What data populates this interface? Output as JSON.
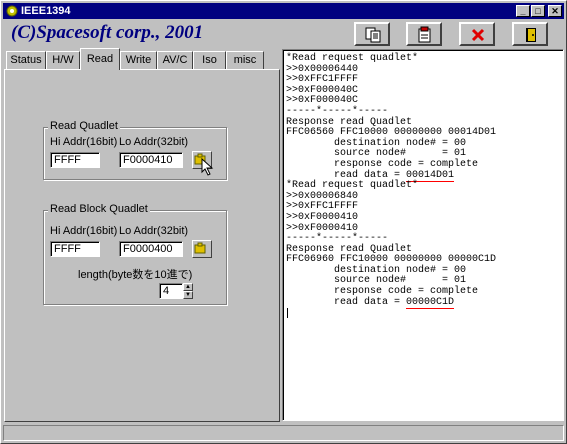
{
  "window": {
    "title": "IEEE1394"
  },
  "header": {
    "brand": "(C)Spacesoft corp., 2001"
  },
  "toolbar": {
    "buttons": [
      {
        "icon": "copy-doc-icon"
      },
      {
        "icon": "paste-doc-icon"
      },
      {
        "icon": "clear-x-icon"
      },
      {
        "icon": "exit-door-icon"
      }
    ]
  },
  "tabs": [
    "Status",
    "H/W",
    "Read",
    "Write",
    "AV/C",
    "Iso",
    "misc"
  ],
  "active_tab": "Read",
  "read_quadlet": {
    "group_label": "Read Quadlet",
    "hi_label": "Hi Addr(16bit)",
    "lo_label": "Lo Addr(32bit)",
    "hi_value": "FFFF",
    "lo_value": "F0000410"
  },
  "read_block": {
    "group_label": "Read Block Quadlet",
    "hi_label": "Hi Addr(16bit)",
    "lo_label": "Lo Addr(32bit)",
    "hi_value": "FFFF",
    "lo_value": "F0000400",
    "length_label": "length(byte数を10進で)",
    "length_value": "4"
  },
  "log": {
    "lines": [
      "*Read request quadlet*",
      ">>0x00006440",
      ">>0xFFC1FFFF",
      ">>0xF000040C",
      ">>0xF000040C",
      "-----*-----*-----",
      "Response read Quadlet",
      "FFC06560 FFC10000 00000000 00014D01",
      "        destination node# = 00",
      "        source node#      = 01",
      "        response code = complete",
      "        read data = |00014D01|",
      "*Read request quadlet*",
      ">>0x00006840",
      ">>0xFFC1FFFF",
      ">>0xF0000410",
      ">>0xF0000410",
      "-----*-----*-----",
      "Response read Quadlet",
      "FFC06960 FFC10000 00000000 00000C1D",
      "        destination node# = 00",
      "        source node#      = 01",
      "        response code = complete",
      "        read data = |00000C1D|"
    ]
  },
  "colors": {
    "title_bar": "#000080",
    "brand_text": "#000080",
    "highlight_underline": "#ff0000"
  }
}
